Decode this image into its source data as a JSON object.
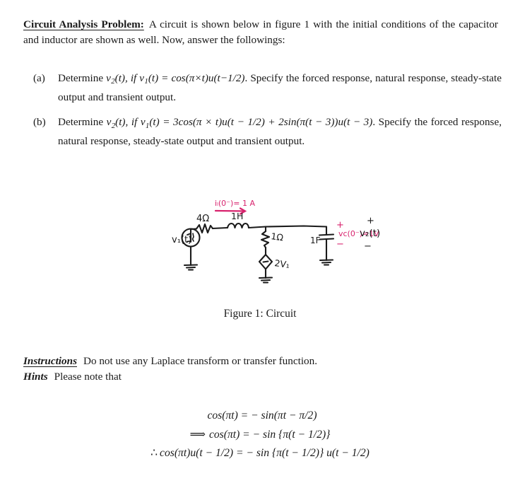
{
  "document": {
    "intro": {
      "title": "Circuit Analysis Problem:",
      "body": "A circuit is shown below in figure 1 with the initial conditions of the capacitor and inductor are shown as well. Now, answer the followings:"
    },
    "questions": [
      {
        "label": "(a)",
        "text_1": "Determine ",
        "v2": "v",
        "v2_sub": "2",
        "text_2": "(t), if ",
        "v1": "v",
        "v1_sub": "1",
        "text_3": "(t) = ",
        "expression": "cos(π×t)u(t−1/2)",
        "text_4": ". Specify the forced response, natural response, steady-state output and transient output."
      },
      {
        "label": "(b)",
        "text_1": "Determine ",
        "v2": "v",
        "v2_sub": "2",
        "text_2": "(t), if ",
        "v1": "v",
        "v1_sub": "1",
        "text_3": "(t) = ",
        "expression": "3cos(π × t)u(t − 1/2) + 2sin(π(t − 3))u(t − 3)",
        "text_4": ". Specify the forced response, natural response, steady-state output and transient output."
      }
    ],
    "figure": {
      "caption_number": "Figure 1:",
      "caption_text": "Circuit",
      "circuit": {
        "source_label": "v₁(t)",
        "resistor_series": "4Ω",
        "inductor": "1H",
        "resistor_shunt": "1Ω",
        "dependent_source": "2V₁",
        "capacitor": "1F",
        "inductor_ic": "iₗ(0⁻)= 1 A",
        "capacitor_ic": "vс(0⁻)=1V",
        "output_label": "v₂(t)",
        "plus_sign": "+",
        "minus_sign": "−",
        "ink_color": "#1a1a1a",
        "annotation_color": "#d8246e"
      }
    },
    "notes": {
      "instructions_key": "Instructions",
      "instructions_text": "Do not use any Laplace transform or transfer function.",
      "hints_key": "Hints",
      "hints_text": "Please note that"
    },
    "equations": [
      {
        "prefix": "",
        "body": "cos(πt) = − sin(πt − π/2)"
      },
      {
        "prefix": "⟹",
        "body": "cos(πt) = − sin {π(t − 1/2)}"
      },
      {
        "prefix": "∴",
        "body": "cos(πt)u(t − 1/2) = − sin {π(t − 1/2)} u(t − 1/2)"
      }
    ]
  }
}
